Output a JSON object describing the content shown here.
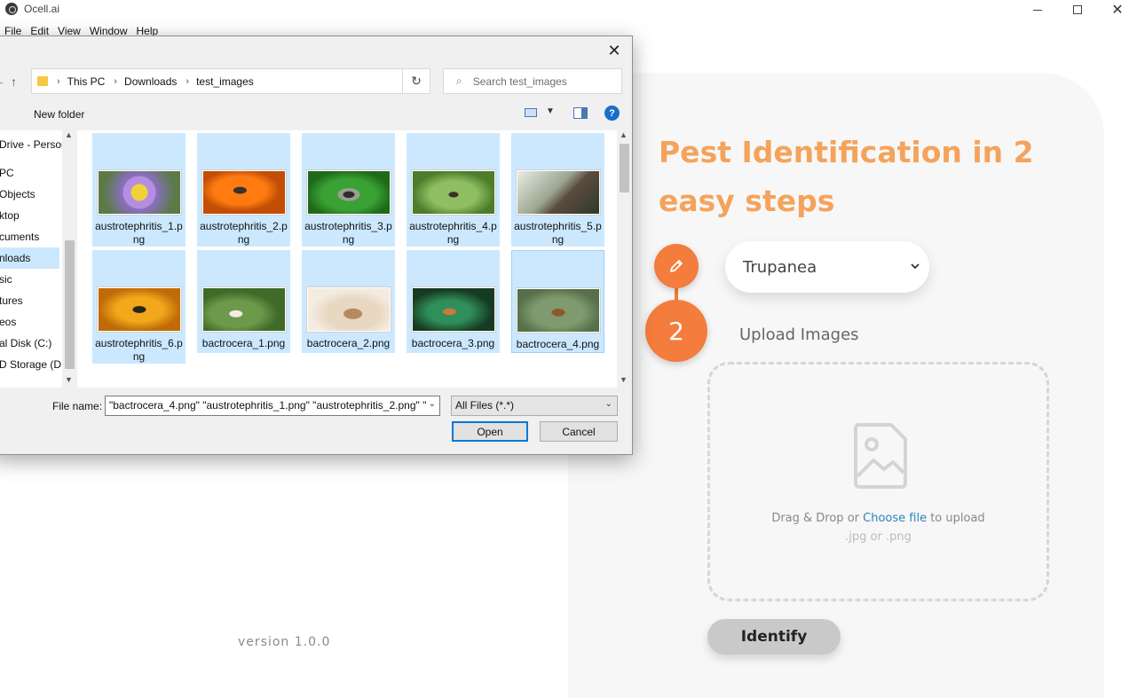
{
  "window": {
    "title": "Ocell.ai",
    "menu": [
      "File",
      "Edit",
      "View",
      "Window",
      "Help"
    ]
  },
  "app": {
    "headline": "Pest Identification in 2 easy steps",
    "step2_number": "2",
    "species_selected": "Trupanea",
    "upload_label": "Upload Images",
    "dropzone": {
      "text_before": "Drag & Drop or ",
      "link": "Choose file",
      "text_after": " to upload",
      "formats": ".jpg or .png"
    },
    "identify_label": "Identify",
    "version": "version 1.0.0",
    "accent_color": "#f47c3c",
    "heading_color": "#f5a35c"
  },
  "dialog": {
    "breadcrumb": [
      "This PC",
      "Downloads",
      "test_images"
    ],
    "search_placeholder": "Search test_images",
    "new_folder": "New folder",
    "help_icon_label": "?",
    "nav_items": [
      "Drive - Person",
      "PC",
      "Objects",
      "ktop",
      "cuments",
      "nloads",
      "sic",
      "tures",
      "eos",
      "al Disk (C:)",
      "D Storage (D:"
    ],
    "selected_nav": "nloads",
    "files": [
      {
        "name": "austrotephritis_1.png",
        "thumb": "purple-flower-fly"
      },
      {
        "name": "austrotephritis_2.png",
        "thumb": "orange-flower-fly"
      },
      {
        "name": "austrotephritis_3.png",
        "thumb": "green-leaf-fly"
      },
      {
        "name": "austrotephritis_4.png",
        "thumb": "leaf-fly"
      },
      {
        "name": "austrotephritis_5.png",
        "thumb": "stem-fly"
      },
      {
        "name": "austrotephritis_6.png",
        "thumb": "yellow-flower-fly"
      },
      {
        "name": "bactrocera_1.png",
        "thumb": "leaf-fly-white"
      },
      {
        "name": "bactrocera_2.png",
        "thumb": "wing-closeup"
      },
      {
        "name": "bactrocera_3.png",
        "thumb": "dark-leaf-fly"
      },
      {
        "name": "bactrocera_4.png",
        "thumb": "grey-leaf-fly"
      }
    ],
    "file_name_label": "File name:",
    "file_name_value": "\"bactrocera_4.png\" \"austrotephritis_1.png\" \"austrotephritis_2.png\" \"",
    "filter_value": "All Files (*.*)",
    "open_label": "Open",
    "cancel_label": "Cancel"
  }
}
